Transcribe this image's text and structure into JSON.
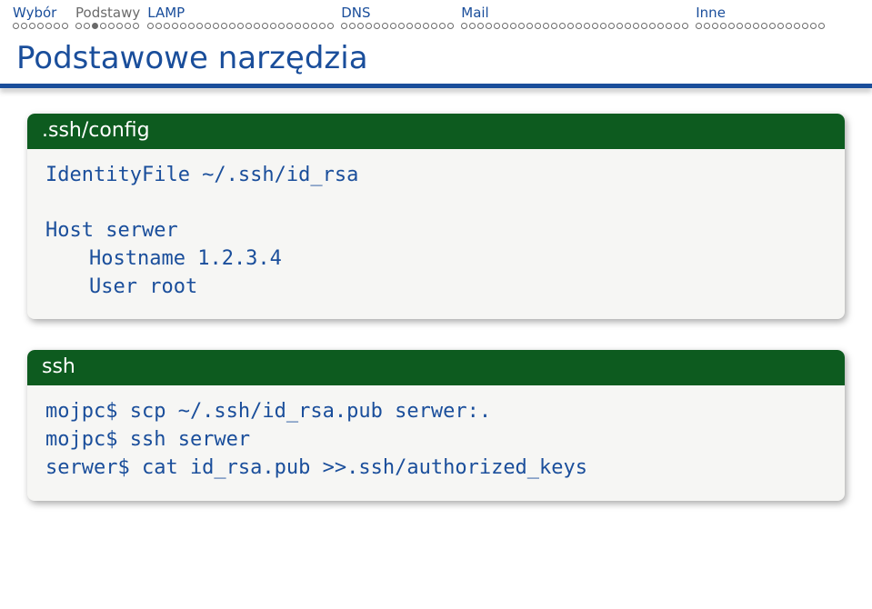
{
  "nav": [
    {
      "label": "Wybór",
      "active": false,
      "dots": 7,
      "filled": []
    },
    {
      "label": "Podstawy",
      "active": true,
      "dots": 8,
      "filled": [
        2
      ]
    },
    {
      "label": "LAMP",
      "active": false,
      "dots": 23,
      "filled": []
    },
    {
      "label": "DNS",
      "active": false,
      "dots": 14,
      "filled": []
    },
    {
      "label": "Mail",
      "active": false,
      "dots": 28,
      "filled": []
    },
    {
      "label": "Inne",
      "active": false,
      "dots": 16,
      "filled": []
    }
  ],
  "title": "Podstawowe narzędzia",
  "block1": {
    "header": ".ssh/config",
    "line1": "IdentityFile ~/.ssh/id_rsa",
    "line2": "Host serwer",
    "line3": "Hostname 1.2.3.4",
    "line4": "User root"
  },
  "block2": {
    "header": "ssh",
    "line1": "mojpc$ scp ~/.ssh/id_rsa.pub serwer:.",
    "line2": "mojpc$ ssh serwer",
    "line3": "serwer$ cat id_rsa.pub >>.ssh/authorized_keys"
  }
}
